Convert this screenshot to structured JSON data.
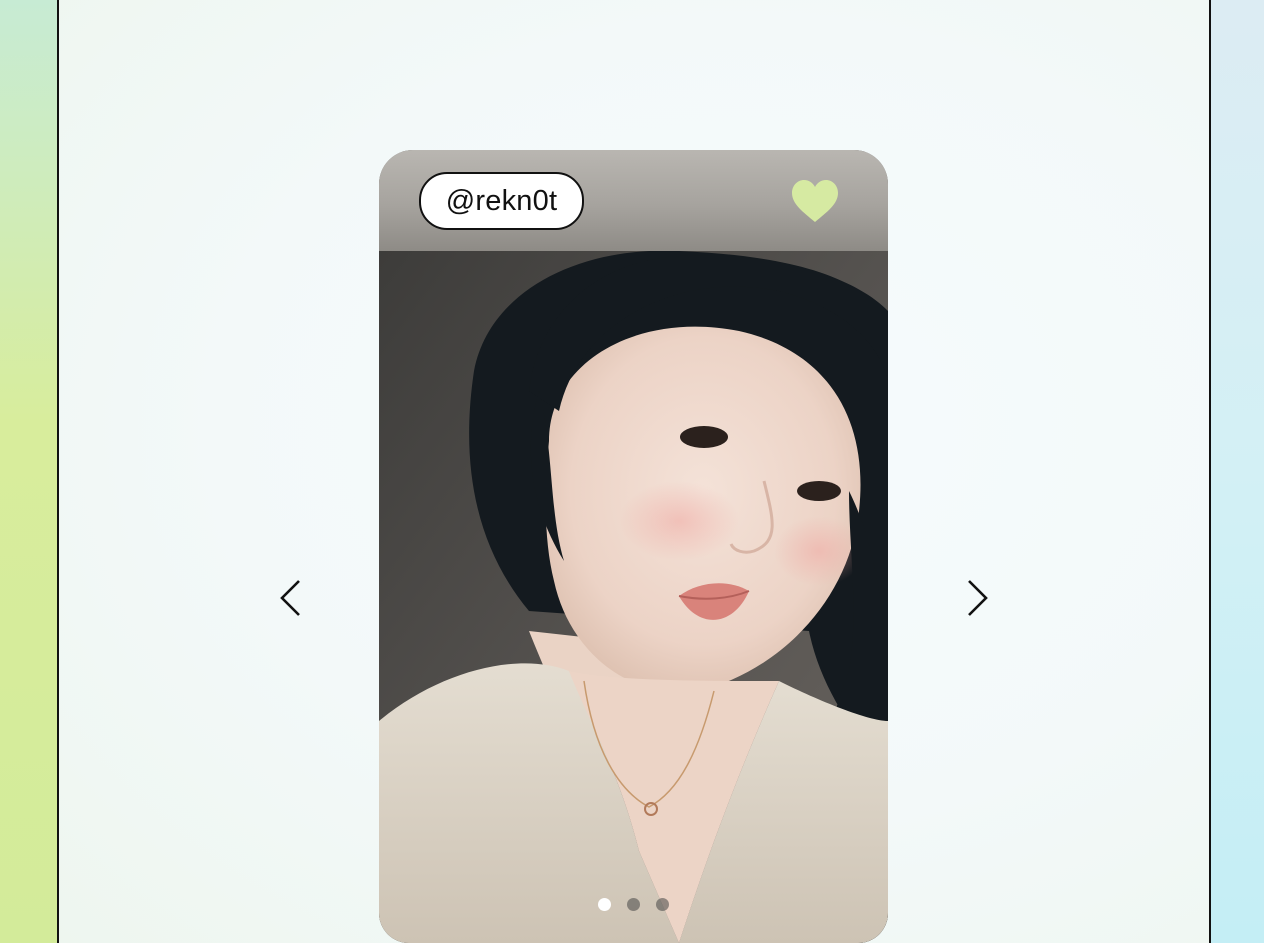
{
  "post": {
    "username": "@rekn0t",
    "liked": true,
    "heart_color": "#d6eaa2",
    "photo_description_icon": "portrait-photo"
  },
  "carousel": {
    "total_slides": 3,
    "active_slide": 1,
    "prev_icon": "chevron-left-icon",
    "next_icon": "chevron-right-icon"
  },
  "theme": {
    "accent": "#d6eaa2",
    "frame_border": "#111111"
  }
}
